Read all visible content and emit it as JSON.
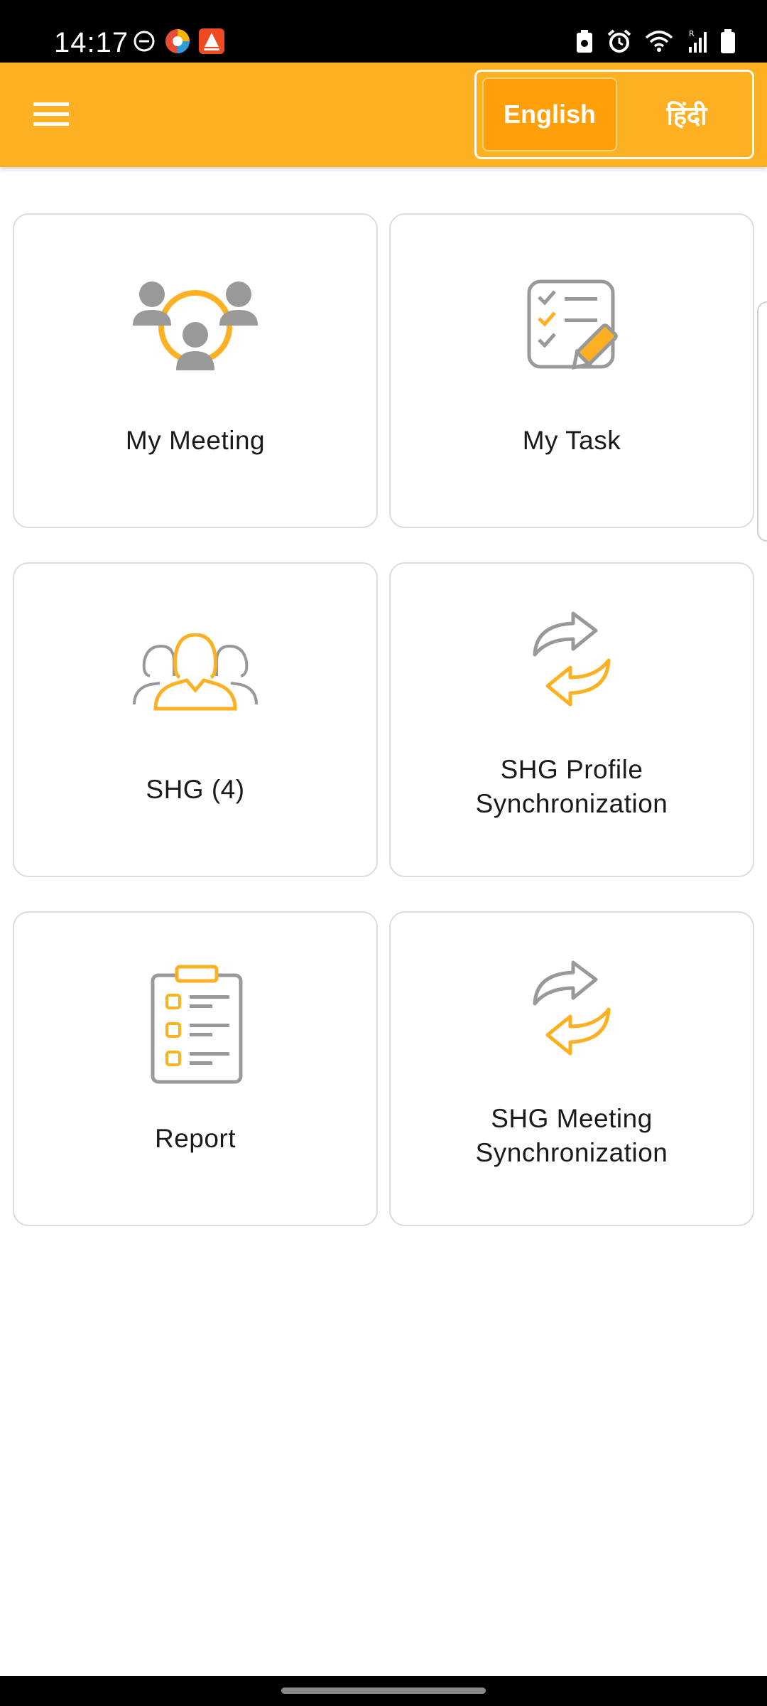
{
  "status_bar": {
    "time": "14:17",
    "left_icons": [
      "dnd-icon",
      "app-notification-icon",
      "app-alert-icon"
    ],
    "right_icons": [
      "battery-saver-icon",
      "alarm-icon",
      "wifi-icon",
      "signal-icon",
      "battery-icon"
    ]
  },
  "app_bar": {
    "menu_icon": "hamburger-menu-icon",
    "languages": {
      "english": "English",
      "hindi": "हिंदी",
      "selected": "english"
    }
  },
  "colors": {
    "accent": "#fdb022",
    "accent_dark": "#ff9f0a",
    "icon_gray": "#999999",
    "card_border": "#dcdcdc"
  },
  "tiles": [
    {
      "label": "My Meeting",
      "icon": "meeting-group-icon"
    },
    {
      "label": "My Task",
      "icon": "task-checklist-icon"
    },
    {
      "label": "SHG (4)",
      "icon": "shg-women-group-icon"
    },
    {
      "label": "SHG Profile Synchronization",
      "label_lines": [
        "SHG Profile",
        "Synchronization"
      ],
      "icon": "sync-arrows-icon"
    },
    {
      "label": "Report",
      "icon": "report-clipboard-icon"
    },
    {
      "label": "SHG Meeting Synchronization",
      "label_lines": [
        "SHG Meeting",
        "Synchronization"
      ],
      "icon": "sync-arrows-icon"
    }
  ]
}
